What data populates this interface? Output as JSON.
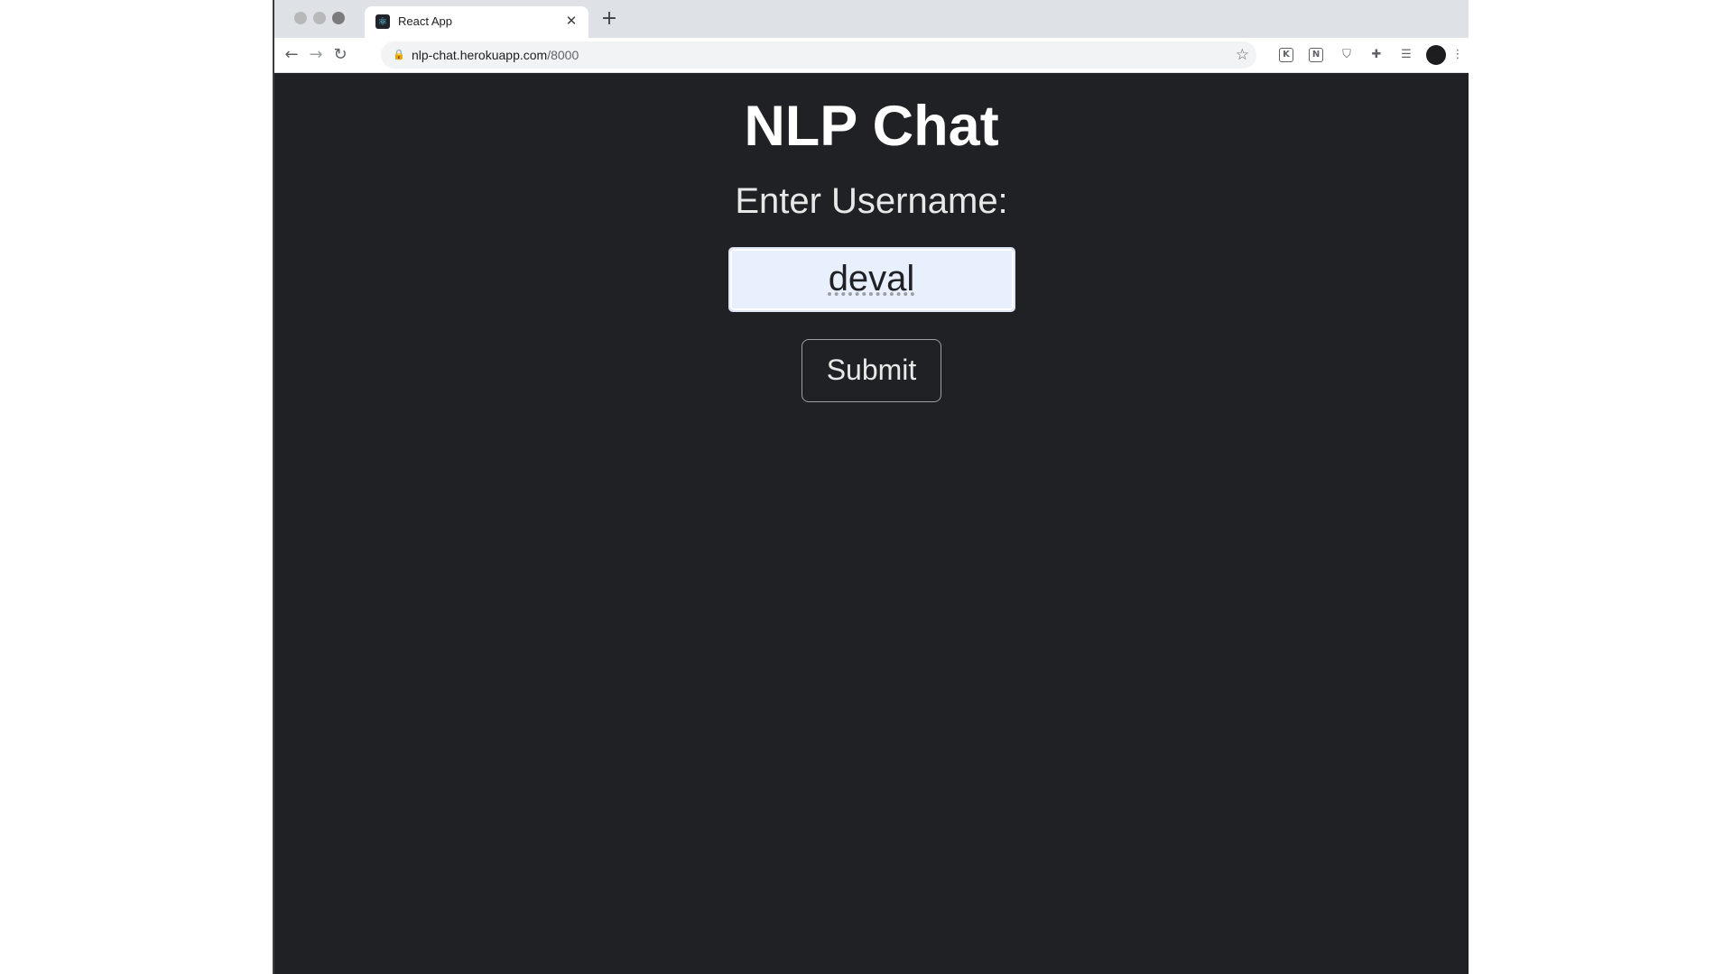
{
  "browser": {
    "tab": {
      "title": "React App",
      "favicon": "react-icon",
      "close_glyph": "✕"
    },
    "new_tab_glyph": "+",
    "toolbar": {
      "back_icon": "back-arrow-icon",
      "forward_icon": "forward-arrow-icon",
      "reload_icon": "reload-icon",
      "url_host": "nlp-chat.herokuapp.com",
      "url_path": "/8000",
      "extensions": [
        "extension-k-icon",
        "notion-icon",
        "shield-icon",
        "puzzle-icon",
        "reading-list-icon"
      ],
      "menu_icon": "kebab-menu-icon"
    }
  },
  "app": {
    "title": "NLP Chat",
    "prompt": "Enter Username:",
    "username_value": "deval",
    "submit_label": "Submit"
  },
  "colors": {
    "page_background": "#202124",
    "title_text": "#ffffff",
    "input_background": "#e8f0fe"
  }
}
